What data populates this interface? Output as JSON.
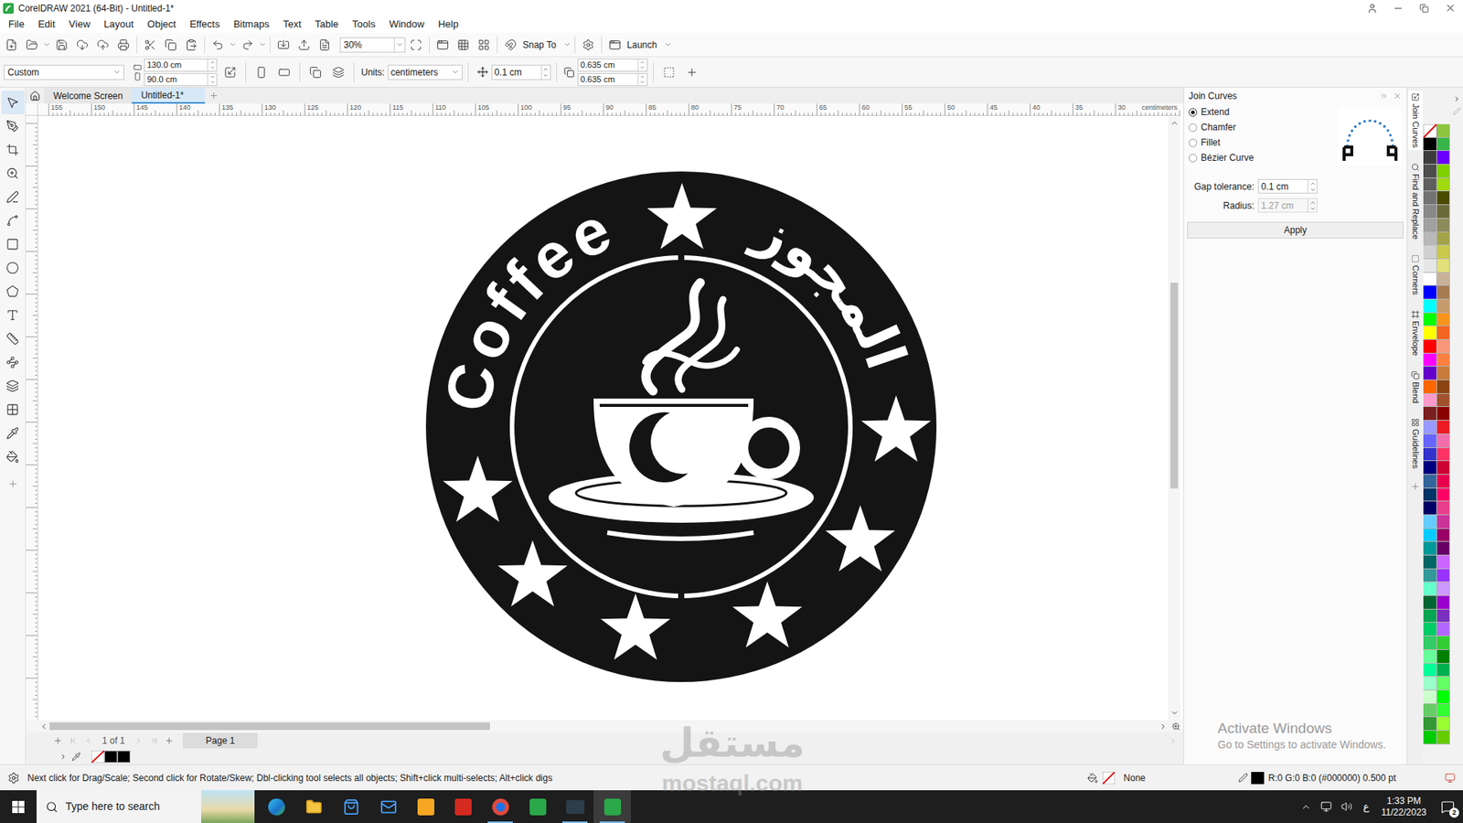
{
  "window": {
    "title": "CorelDRAW 2021 (64-Bit) - Untitled-1*"
  },
  "menu": [
    "File",
    "Edit",
    "View",
    "Layout",
    "Object",
    "Effects",
    "Bitmaps",
    "Text",
    "Table",
    "Tools",
    "Window",
    "Help"
  ],
  "toolbar": {
    "zoom": "30%",
    "snap": "Snap To",
    "launch": "Launch"
  },
  "property_bar": {
    "preset": "Custom",
    "width": "130.0 cm",
    "height": "90.0 cm",
    "units_label": "Units:",
    "units": "centimeters",
    "nudge": "0.1 cm",
    "dup_x": "0.635 cm",
    "dup_y": "0.635 cm"
  },
  "doc_tabs": [
    {
      "label": "Welcome Screen",
      "selected": false
    },
    {
      "label": "Untitled-1*",
      "selected": true
    }
  ],
  "ruler": {
    "ticks": [
      "155",
      "150",
      "145",
      "140",
      "135",
      "130",
      "125",
      "120",
      "115",
      "110",
      "105",
      "100",
      "95",
      "90",
      "85",
      "80",
      "75",
      "70",
      "65",
      "60",
      "55",
      "50",
      "45",
      "40",
      "35",
      "30"
    ],
    "unit": "centimeters"
  },
  "artwork": {
    "text_left": "Coffee",
    "text_right": "المجوز"
  },
  "docker": {
    "title": "Join Curves",
    "options": [
      {
        "label": "Extend",
        "selected": true
      },
      {
        "label": "Chamfer",
        "selected": false
      },
      {
        "label": "Fillet",
        "selected": false
      },
      {
        "label": "Bézier Curve",
        "selected": false
      }
    ],
    "gap_label": "Gap tolerance:",
    "gap": "0.1 cm",
    "radius_label": "Radius:",
    "radius": "1.27 cm",
    "radius_disabled": true,
    "apply": "Apply"
  },
  "docker_tabs": [
    {
      "label": "Join Curves",
      "selected": true
    },
    {
      "label": "Find and Replace",
      "selected": false
    },
    {
      "label": "Corners",
      "selected": false
    },
    {
      "label": "Envelope",
      "selected": false
    },
    {
      "label": "Blend",
      "selected": false
    },
    {
      "label": "Guidelines",
      "selected": false
    }
  ],
  "palette": [
    {
      "kind": "none"
    },
    {
      "kind": "swatch",
      "color": "#8cc63f"
    },
    {
      "kind": "swatch",
      "color": "#000000"
    },
    {
      "kind": "swatch",
      "color": "#39b54a"
    },
    {
      "kind": "swatch",
      "color": "#3c3c3c"
    },
    {
      "kind": "swatch",
      "color": "#6a00ff"
    },
    {
      "kind": "swatch",
      "color": "#4d4d4d"
    },
    {
      "kind": "swatch",
      "color": "#7fd000"
    },
    {
      "kind": "swatch",
      "color": "#5f5f5f"
    },
    {
      "kind": "swatch",
      "color": "#a0d911"
    },
    {
      "kind": "swatch",
      "color": "#737373"
    },
    {
      "kind": "swatch",
      "color": "#4a4a00"
    },
    {
      "kind": "swatch",
      "color": "#898989"
    },
    {
      "kind": "swatch",
      "color": "#6b6b3a"
    },
    {
      "kind": "swatch",
      "color": "#a0a0a0"
    },
    {
      "kind": "swatch",
      "color": "#8c8c5a"
    },
    {
      "kind": "swatch",
      "color": "#b8b8b8"
    },
    {
      "kind": "swatch",
      "color": "#a3a34a"
    },
    {
      "kind": "swatch",
      "color": "#d0d0d0"
    },
    {
      "kind": "swatch",
      "color": "#c9c94e"
    },
    {
      "kind": "swatch",
      "color": "#e6e6e6"
    },
    {
      "kind": "swatch",
      "color": "#e0e07a"
    },
    {
      "kind": "swatch",
      "color": "#ffffff"
    },
    {
      "kind": "swatch",
      "color": "#c7b299"
    },
    {
      "kind": "swatch",
      "color": "#0000ff"
    },
    {
      "kind": "swatch",
      "color": "#a67c52"
    },
    {
      "kind": "swatch",
      "color": "#00ffff"
    },
    {
      "kind": "swatch",
      "color": "#c69c6d"
    },
    {
      "kind": "swatch",
      "color": "#00ff00"
    },
    {
      "kind": "swatch",
      "color": "#f7941d"
    },
    {
      "kind": "swatch",
      "color": "#ffff00"
    },
    {
      "kind": "swatch",
      "color": "#f26522"
    },
    {
      "kind": "swatch",
      "color": "#ff0000"
    },
    {
      "kind": "swatch",
      "color": "#f7977a"
    },
    {
      "kind": "swatch",
      "color": "#ff00ff"
    },
    {
      "kind": "swatch",
      "color": "#ff8040"
    },
    {
      "kind": "swatch",
      "color": "#6600cc"
    },
    {
      "kind": "swatch",
      "color": "#c77c3c"
    },
    {
      "kind": "swatch",
      "color": "#ff6600"
    },
    {
      "kind": "swatch",
      "color": "#8b4513"
    },
    {
      "kind": "swatch",
      "color": "#ff99cc"
    },
    {
      "kind": "swatch",
      "color": "#a0522d"
    },
    {
      "kind": "swatch",
      "color": "#7a1f1f"
    },
    {
      "kind": "swatch",
      "color": "#8b0000"
    },
    {
      "kind": "swatch",
      "color": "#9999ff"
    },
    {
      "kind": "swatch",
      "color": "#ed1c24"
    },
    {
      "kind": "swatch",
      "color": "#6666ff"
    },
    {
      "kind": "swatch",
      "color": "#f06eaa"
    },
    {
      "kind": "swatch",
      "color": "#3333cc"
    },
    {
      "kind": "swatch",
      "color": "#ff3366"
    },
    {
      "kind": "swatch",
      "color": "#000080"
    },
    {
      "kind": "swatch",
      "color": "#cc0033"
    },
    {
      "kind": "swatch",
      "color": "#336699"
    },
    {
      "kind": "swatch",
      "color": "#e6004c"
    },
    {
      "kind": "swatch",
      "color": "#003366"
    },
    {
      "kind": "swatch",
      "color": "#ff0066"
    },
    {
      "kind": "swatch",
      "color": "#000066"
    },
    {
      "kind": "swatch",
      "color": "#e83e8c"
    },
    {
      "kind": "swatch",
      "color": "#66ccff"
    },
    {
      "kind": "swatch",
      "color": "#cc3399"
    },
    {
      "kind": "swatch",
      "color": "#00ccff"
    },
    {
      "kind": "swatch",
      "color": "#990066"
    },
    {
      "kind": "swatch",
      "color": "#009999"
    },
    {
      "kind": "swatch",
      "color": "#660066"
    },
    {
      "kind": "swatch",
      "color": "#006666"
    },
    {
      "kind": "swatch",
      "color": "#cc66ff"
    },
    {
      "kind": "swatch",
      "color": "#339999"
    },
    {
      "kind": "swatch",
      "color": "#9933ff"
    },
    {
      "kind": "swatch",
      "color": "#66ffcc"
    },
    {
      "kind": "swatch",
      "color": "#cc99ff"
    },
    {
      "kind": "swatch",
      "color": "#006633"
    },
    {
      "kind": "swatch",
      "color": "#9900cc"
    },
    {
      "kind": "swatch",
      "color": "#00a651"
    },
    {
      "kind": "swatch",
      "color": "#7b2fbe"
    },
    {
      "kind": "swatch",
      "color": "#00cc66"
    },
    {
      "kind": "swatch",
      "color": "#b266ff"
    },
    {
      "kind": "swatch",
      "color": "#33cc66"
    },
    {
      "kind": "swatch",
      "color": "#33cc33"
    },
    {
      "kind": "swatch",
      "color": "#66ff99"
    },
    {
      "kind": "swatch",
      "color": "#008000"
    },
    {
      "kind": "swatch",
      "color": "#00ff99"
    },
    {
      "kind": "swatch",
      "color": "#00b050"
    },
    {
      "kind": "swatch",
      "color": "#99ffcc"
    },
    {
      "kind": "swatch",
      "color": "#66ff66"
    },
    {
      "kind": "swatch",
      "color": "#ccffcc"
    },
    {
      "kind": "swatch",
      "color": "#00ff00"
    },
    {
      "kind": "swatch",
      "color": "#66cc66"
    },
    {
      "kind": "swatch",
      "color": "#33ff33"
    },
    {
      "kind": "swatch",
      "color": "#339933"
    },
    {
      "kind": "swatch",
      "color": "#99ff33"
    },
    {
      "kind": "swatch",
      "color": "#00cc00"
    },
    {
      "kind": "swatch",
      "color": "#66cc00"
    }
  ],
  "doc_palette": [
    {
      "color": "#000000"
    },
    {
      "color": "#000000"
    }
  ],
  "page_nav": {
    "position": "1 of 1",
    "page": "Page 1"
  },
  "status_bar": {
    "hint": "Next click for Drag/Scale; Second click for Rotate/Skew; Dbl-clicking tool selects all objects; Shift+click multi-selects; Alt+click digs",
    "fill": "None",
    "outline": "R:0 G:0 B:0 (#000000) 0.500 pt",
    "outline_color": "#000000"
  },
  "watermarks": {
    "activate_title": "Activate Windows",
    "activate_sub": "Go to Settings to activate Windows.",
    "site_logo": "مستقل",
    "site_url": "mostaql.com"
  },
  "taskbar": {
    "search": "Type here to search",
    "lang": "ع",
    "time": "1:33 PM",
    "date": "11/22/2023",
    "notifications": "2"
  }
}
